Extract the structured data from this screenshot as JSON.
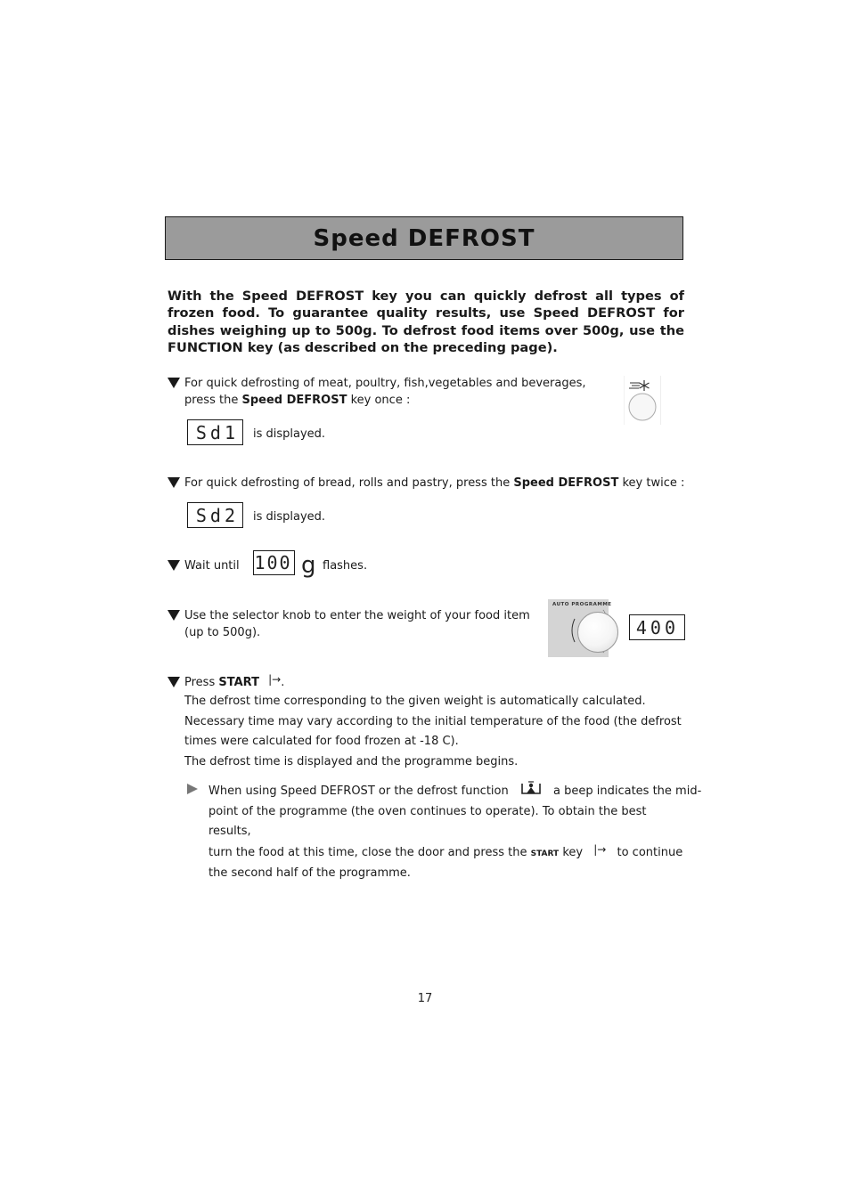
{
  "title": "Speed DEFROST",
  "intro": "With the Speed DEFROST key you can quickly defrost all types of frozen food. To guarantee quality results, use Speed DEFROST for dishes weighing up to 500g.  To defrost food items over 500g, use the FUNCTION key (as described on the preceding page).",
  "steps": [
    {
      "line1": "For quick defrosting of meat, poultry, fish,vegetables and beverages,",
      "line2_pre": "press the ",
      "line2_bold": "Speed DEFROST",
      "line2_post": " key once :",
      "display": "Sd1",
      "display_suffix": "is displayed.",
      "icon": "speed-defrost-key-icon"
    },
    {
      "line_pre": "For quick defrosting of bread, rolls and pastry, press the ",
      "line_bold": "Speed DEFROST",
      "line_post": " key twice :",
      "display": "Sd2",
      "display_suffix": "is displayed."
    },
    {
      "pre": "Wait until",
      "display": "100",
      "unit": "g",
      "post": "flashes."
    },
    {
      "line1": "Use the selector knob to enter the weight of your food item",
      "line2": "(up to 500g).",
      "knob_label": "AUTO PROGRAMME",
      "display": "400"
    },
    {
      "pre": "Press ",
      "bold": "START",
      "start_symbol": "|→",
      "post": ".",
      "lines": [
        "The defrost time corresponding to the given weight is automatically calculated.",
        "Necessary time may vary according to the initial temperature of the food (the defrost",
        "times were calculated for food frozen at -18 C).",
        "The defrost time is displayed and the programme begins."
      ]
    }
  ],
  "note": {
    "part1": "When using Speed DEFROST or the defrost function",
    "part2": "a beep indicates the mid-",
    "line2": "point of the programme (the oven continues to operate).  To obtain the best results,",
    "line3_pre": "turn the food at this time, close the door and press the",
    "line3_start": "START",
    "line3_key": "key",
    "line3_post": "to continue",
    "line4": "the second half of the programme.",
    "start_symbol": "|→"
  },
  "page_number": "17"
}
